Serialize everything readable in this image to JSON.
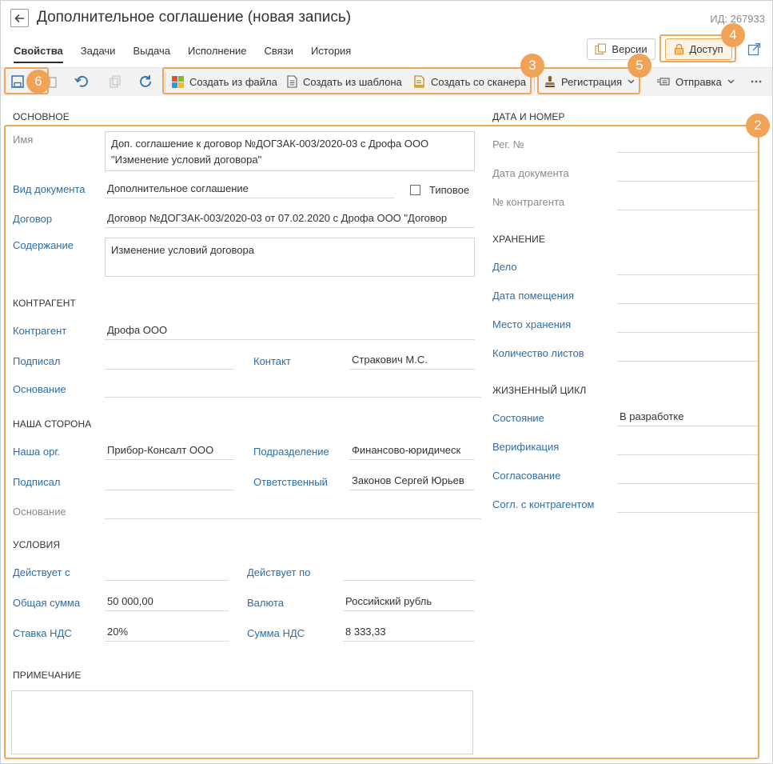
{
  "header": {
    "title": "Дополнительное соглашение (новая запись)",
    "doc_id": "ИД: 267933"
  },
  "tabs": [
    "Свойства",
    "Задачи",
    "Выдача",
    "Исполнение",
    "Связи",
    "История"
  ],
  "top_buttons": {
    "versions": "Версии",
    "access": "Доступ"
  },
  "toolbar": {
    "create_from_file": "Создать из файла",
    "create_from_template": "Создать из шаблона",
    "create_from_scanner": "Создать со сканера",
    "registration": "Регистрация",
    "send": "Отправка"
  },
  "callouts": [
    "2",
    "3",
    "4",
    "5",
    "6"
  ],
  "main": {
    "section_main": "ОСНОВНОЕ",
    "name_label": "Имя",
    "name_value": "Доп. соглашение к договор №ДОГЗАК-003/2020-03 с Дрофа ООО \"Изменение условий договора\"",
    "doc_kind_label": "Вид документа",
    "doc_kind_value": "Дополнительное соглашение",
    "typical_label": "Типовое",
    "contract_label": "Договор",
    "contract_value": "Договор №ДОГЗАК-003/2020-03 от 07.02.2020 с Дрофа ООО \"Договор",
    "content_label": "Содержание",
    "content_value": "Изменение условий договора",
    "section_counterparty": "КОНТРАГЕНТ",
    "counterparty_label": "Контрагент",
    "counterparty_value": "Дрофа ООО",
    "signed_label": "Подписал",
    "signed_value": "",
    "contact_label": "Контакт",
    "contact_value": "Стракович М.С.",
    "basis_label": "Основание",
    "basis_value": "",
    "section_our": "НАША СТОРОНА",
    "our_org_label": "Наша орг.",
    "our_org_value": "Прибор-Консалт ООО",
    "department_label": "Подразделение",
    "department_value": "Финансово-юридическ",
    "our_signed_label": "Подписал",
    "our_signed_value": "",
    "responsible_label": "Ответственный",
    "responsible_value": "Законов Сергей Юрьев",
    "our_basis_label": "Основание",
    "our_basis_value": "",
    "section_terms": "УСЛОВИЯ",
    "valid_from_label": "Действует с",
    "valid_from_value": "",
    "valid_to_label": "Действует по",
    "valid_to_value": "",
    "total_label": "Общая сумма",
    "total_value": "50 000,00",
    "currency_label": "Валюта",
    "currency_value": "Российский рубль",
    "vat_rate_label": "Ставка НДС",
    "vat_rate_value": "20%",
    "vat_sum_label": "Сумма НДС",
    "vat_sum_value": "8 333,33",
    "section_note": "ПРИМЕЧАНИЕ",
    "note_value": ""
  },
  "side": {
    "section_date": "ДАТА И НОМЕР",
    "reg_no_label": "Рег. №",
    "reg_no_value": "",
    "doc_date_label": "Дата документа",
    "doc_date_value": "",
    "cp_no_label": "№ контрагента",
    "cp_no_value": "",
    "section_storage": "ХРАНЕНИЕ",
    "case_label": "Дело",
    "case_value": "",
    "placement_date_label": "Дата помещения",
    "placement_date_value": "",
    "storage_place_label": "Место хранения",
    "storage_place_value": "",
    "sheets_label": "Количество листов",
    "sheets_value": "",
    "section_lifecycle": "ЖИЗНЕННЫЙ ЦИКЛ",
    "state_label": "Состояние",
    "state_value": "В разработке",
    "verification_label": "Верификация",
    "verification_value": "",
    "approval_label": "Согласование",
    "approval_value": "",
    "cp_approval_label": "Согл. с контрагентом",
    "cp_approval_value": ""
  },
  "colors": {
    "accent_orange": "#f0a257",
    "link_blue": "#2e6da4",
    "toolbar_bg": "#f2f2f2"
  }
}
